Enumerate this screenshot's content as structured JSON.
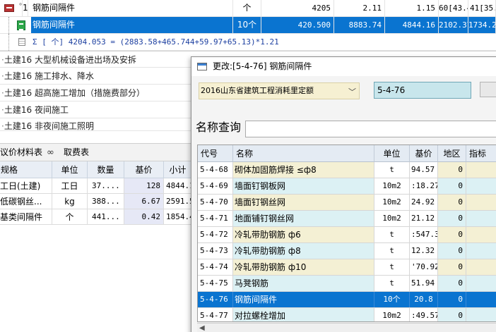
{
  "top_rows": [
    {
      "tree": "1",
      "name": "钢筋间隔件",
      "unit": "个",
      "qty": "4205",
      "price": "2.11",
      "v1": "1.15",
      "v2": "60[43.4%]",
      "v3": "41[35.8%]"
    },
    {
      "name": "钢筋间隔件",
      "unit": "10个",
      "qty": "420.500",
      "price": "8883.74",
      "v1": "4844.16",
      "v2": "2102.37",
      "v3": "1734.21"
    },
    {
      "formula": "Σ [ 个] 4204.053 = (2883.58+465.744+59.97+65.13)*1.21"
    }
  ],
  "group_rows": [
    {
      "tag": "土建16",
      "name": "大型机械设备进出场及安拆"
    },
    {
      "tag": "土建16",
      "name": "施工排水、降水"
    },
    {
      "tag": "土建16",
      "name": "超高施工增加（措施费部分）"
    },
    {
      "tag": "土建16",
      "name": "夜间施工"
    },
    {
      "tag": "土建16",
      "name": "非夜间施工照明"
    }
  ],
  "left_tabs": {
    "tab1": "议价材料表",
    "tab2": "取费表"
  },
  "left_table": {
    "headers": [
      "规格",
      "单位",
      "数量",
      "基价",
      "小计"
    ],
    "rows": [
      [
        "工日(土建)",
        "工日",
        "37....",
        "128",
        "4844.1"
      ],
      [
        "低碳钢丝...",
        "kg",
        "388...",
        "6.67",
        "2591.5"
      ],
      [
        "基类间隔件",
        "个",
        "441...",
        "0.42",
        "1854.4"
      ]
    ]
  },
  "dialog": {
    "title": "更改:[5-4-76] 钢筋间隔件",
    "quota_select": "2016山东省建筑工程消耗里定额",
    "code_value": "5-4-76",
    "name_query_label": "名称查询",
    "headers": [
      "代号",
      "名称",
      "单位",
      "基价",
      "地区",
      "指标"
    ],
    "rows": [
      {
        "code": "5-4-68",
        "name": "砌体加固筋焊接  ≤ф8",
        "unit": "t",
        "price": "94.57",
        "area": "0",
        "style": "yel"
      },
      {
        "code": "5-4-69",
        "name": "墙面钉钢板网",
        "unit": "10m2",
        "price": ":18.27",
        "area": "0",
        "style": "cyan"
      },
      {
        "code": "5-4-70",
        "name": "墙面钉钢丝网",
        "unit": "10m2",
        "price": "24.92",
        "area": "0",
        "style": "yel"
      },
      {
        "code": "5-4-71",
        "name": "地面铺钉钢丝网",
        "unit": "10m2",
        "price": "21.12",
        "area": "0",
        "style": "cyan"
      },
      {
        "code": "5-4-72",
        "name": "冷轧带肋钢筋 ф6",
        "unit": "t",
        "price": ":547.3",
        "area": "0",
        "style": "yel"
      },
      {
        "code": "5-4-73",
        "name": "冷轧带肋钢筋 ф8",
        "unit": "t",
        "price": "12.32",
        "area": "0",
        "style": "cyan"
      },
      {
        "code": "5-4-74",
        "name": "冷轧带肋钢筋 ф10",
        "unit": "t",
        "price": "'70.92",
        "area": "0",
        "style": "yel"
      },
      {
        "code": "5-4-75",
        "name": "马凳钢筋",
        "unit": "t",
        "price": "51.94",
        "area": "0",
        "style": "cyan"
      },
      {
        "code": "5-4-76",
        "name": "钢筋间隔件",
        "unit": "10个",
        "price": "20.8",
        "area": "0",
        "style": "sel"
      },
      {
        "code": "5-4-77",
        "name": "对拉螺栓增加",
        "unit": "10m2",
        "price": ":49.57",
        "area": "0",
        "style": "cyan"
      }
    ]
  }
}
